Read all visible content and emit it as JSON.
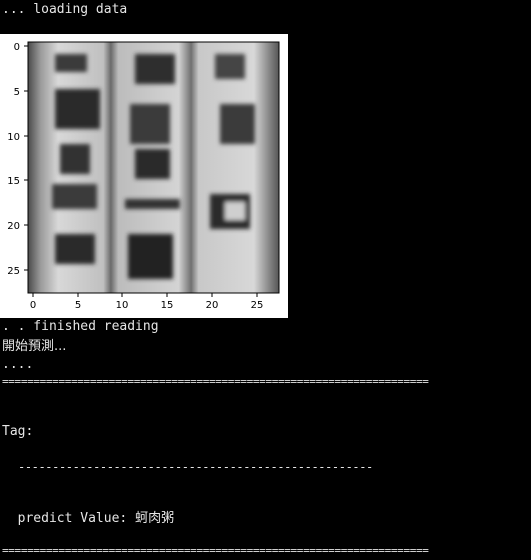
{
  "console": {
    "lines": {
      "loading": "... loading data",
      "finished": ". . finished reading",
      "start_predict": "開始預測...",
      "dots": "....",
      "separator": "====================================================================",
      "tag_label": "Tag:",
      "dashes": "----------------------------------------------------",
      "predict_prefix": "predict Value: ",
      "predict_value": "蚵肉粥",
      "separator_bottom": "===================================================================="
    }
  },
  "image_plot": {
    "x_ticks": [
      "0",
      "5",
      "10",
      "15",
      "20",
      "25"
    ],
    "y_ticks": [
      "0",
      "5",
      "10",
      "15",
      "20",
      "25"
    ],
    "image_description_icon": "grayscale-image"
  }
}
